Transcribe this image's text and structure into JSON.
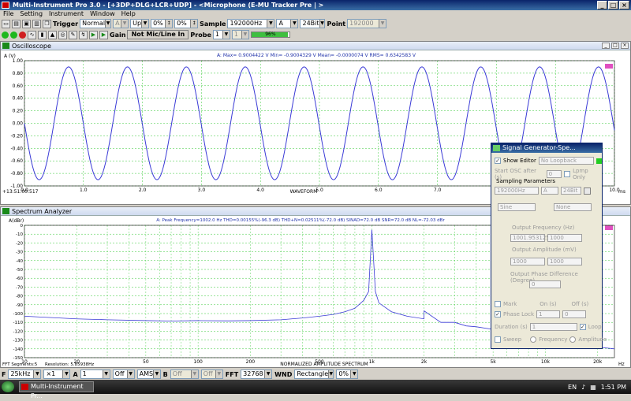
{
  "window": {
    "title": "Multi-Instrument Pro 3.0   - [+3DP+DLG+LCR+UDP]   - <Microphone (E-MU Tracker Pre | >",
    "controls": [
      "_",
      "□",
      "×"
    ]
  },
  "menu": [
    "File",
    "Setting",
    "Instrument",
    "Window",
    "Help"
  ],
  "toolbar1": {
    "trigger_label": "Trigger",
    "trigger_mode": "Normal",
    "trigger_channel": "A",
    "trigger_edge": "Up",
    "trigger_level": "0%",
    "pretrigger": "0%",
    "sample_label": "Sample",
    "sample_rate": "192000Hz",
    "channel": "A",
    "bit_depth": "24Bit",
    "point_label": "Point",
    "points": "192000"
  },
  "toolbar2": {
    "gain_label": "Gain",
    "input_button": "Not Mic/Line In",
    "probe_label": "Probe",
    "probe_a": "1",
    "probe_b": "1",
    "progress_text": "96%",
    "progress_value": 0.96
  },
  "oscilloscope": {
    "title": "Oscilloscope",
    "stats": "A: Max= 0.9004422 V  Min= -0.9004329 V  Mean= -0.0000074 V  RMS= 0.6342583 V",
    "ylabel": "A (V)",
    "xlabel": "WAVEFORM",
    "xunit": "ms",
    "timestamp": "+13:51:00:517"
  },
  "spectrum": {
    "title": "Spectrum Analyzer",
    "stats": "A: Peak Frequency=1002.0 Hz  THD=0.00155%(-96.3 dB)  THD+N=0.02511%(-72.0 dB)  SINAD=72.0 dB  SNR=72.0 dB  NL=-72.03 dBr",
    "ylabel": "A(dBr)",
    "xlabel": "NORMALIZED AMPLITUDE SPECTRUM",
    "xunit": "Hz",
    "segments": "FFT Segments:5",
    "resolution": "Resolution: 5.85938Hz"
  },
  "chart_data": [
    {
      "type": "line",
      "title": "Oscilloscope",
      "xlabel": "WAVEFORM",
      "ylabel": "A (V)",
      "xlim": [
        0,
        10
      ],
      "ylim": [
        -1.0,
        1.0
      ],
      "x_ticks": [
        "0.0",
        "1.0",
        "2.0",
        "3.0",
        "4.0",
        "5.0",
        "6.0",
        "7.0",
        "8.0",
        "9.0",
        "10.0"
      ],
      "y_ticks": [
        "1.00",
        "0.80",
        "0.60",
        "0.40",
        "0.20",
        "0.00",
        "-0.20",
        "-0.40",
        "-0.60",
        "-0.80",
        "-1.00"
      ],
      "grid": true,
      "series": [
        {
          "name": "A",
          "waveform": "sine",
          "frequency_hz": 1002.0,
          "amplitude_v": 0.9004,
          "color": "#3a3ad6"
        }
      ]
    },
    {
      "type": "line",
      "title": "Spectrum Analyzer",
      "xlabel": "NORMALIZED AMPLITUDE SPECTRUM",
      "ylabel": "A(dBr)",
      "xscale": "log",
      "xlim": [
        10,
        25000
      ],
      "ylim": [
        -150,
        0
      ],
      "x_ticks": [
        "10",
        "20",
        "50",
        "100",
        "200",
        "500",
        "1k",
        "2k",
        "5k",
        "10k",
        "20k"
      ],
      "y_ticks": [
        "0",
        "-10",
        "-20",
        "-30",
        "-40",
        "-50",
        "-60",
        "-70",
        "-80",
        "-90",
        "-100",
        "-110",
        "-120",
        "-130",
        "-140",
        "-150"
      ],
      "grid": true,
      "series": [
        {
          "name": "A",
          "color": "#3a3ad6",
          "points": [
            [
              10,
              -103
            ],
            [
              20,
              -106
            ],
            [
              30,
              -107
            ],
            [
              50,
              -108
            ],
            [
              70,
              -108.5
            ],
            [
              100,
              -108
            ],
            [
              150,
              -108.3
            ],
            [
              200,
              -108
            ],
            [
              300,
              -107
            ],
            [
              400,
              -105
            ],
            [
              500,
              -103
            ],
            [
              600,
              -101
            ],
            [
              700,
              -98
            ],
            [
              800,
              -94
            ],
            [
              900,
              -85
            ],
            [
              960,
              -75
            ],
            [
              1002,
              -5
            ],
            [
              1050,
              -75
            ],
            [
              1100,
              -88
            ],
            [
              1300,
              -98
            ],
            [
              1600,
              -103
            ],
            [
              2000,
              -106
            ],
            [
              2004,
              -97
            ],
            [
              2500,
              -110
            ],
            [
              3006,
              -110
            ],
            [
              3500,
              -114
            ],
            [
              4008,
              -115
            ],
            [
              5000,
              -118
            ],
            [
              6012,
              -120
            ],
            [
              8000,
              -125
            ],
            [
              10000,
              -128
            ],
            [
              15000,
              -133
            ],
            [
              20000,
              -138
            ],
            [
              25000,
              -140
            ]
          ]
        }
      ]
    }
  ],
  "signal_generator": {
    "title": "Signal Generator-Spe...",
    "show_editor_label": "Show Editor",
    "show_editor_checked": true,
    "loopback": "No Loopback",
    "start_osc_label": "Start OSC after (s)",
    "start_osc_value": "0",
    "lpmp_only": "Lpmp Only",
    "sampling_params_label": "Sampling Parameters",
    "sampling_rate": "192000Hz",
    "sampling_channel": "A",
    "sampling_bits": "24Bit",
    "waveform_a": "Sine",
    "waveform_b": "None",
    "freq_label": "Output Frequency (Hz)",
    "freq_a": "1001.953125",
    "freq_b": "1000",
    "amp_label": "Output Amplitude (mV)",
    "amp_a": "1000",
    "amp_b": "1000",
    "phase_label": "Output Phase Difference (Degree)",
    "phase_value": "0",
    "mark_label": "Mark",
    "on_label": "On (s)",
    "off_label": "Off (s)",
    "phase_lock_label": "Phase Lock",
    "on_value": "1",
    "off_value": "0",
    "duration_label": "Duration (s)",
    "duration_value": "1",
    "loop_label": "Loop",
    "sweep_label": "Sweep",
    "frequency_label": "Frequency",
    "amplitude_label": "Amplitude"
  },
  "bottombar": {
    "f_label": "F",
    "fft_range": "25kHz",
    "zoom": "×1",
    "channel": "A",
    "channel_count": "1",
    "off1": "Off",
    "ams": "AMS",
    "b_label": "B",
    "off2": "Off",
    "off3": "Off",
    "fft_label": "FFT",
    "fft_size": "32768",
    "wnd_label": "WND",
    "window_fn": "Rectangle",
    "overlap": "0%"
  },
  "taskbar": {
    "item": "Multi-Instrument Pr...",
    "lang": "EN",
    "time": "1:51 PM"
  }
}
